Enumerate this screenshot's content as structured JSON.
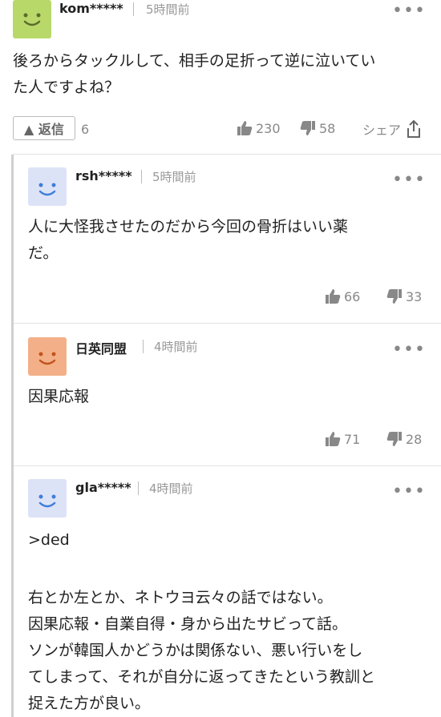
{
  "comment": {
    "username": "kom*****",
    "time": "5時間前",
    "text_line1": "後ろからタックルして、相手の足折って逆に泣いてい",
    "text_line2": "た人ですよね？",
    "reply_label": "▲ 返信",
    "reply_count": "6",
    "likes": "230",
    "dislikes": "58",
    "share": "シェア",
    "avatar_color": "#b9d86a"
  },
  "replies": [
    {
      "username": "rsh*****",
      "time": "5時間前",
      "lines": [
        "人に大怪我させたのだから今回の骨折はいい薬",
        "だ。"
      ],
      "likes": "66",
      "dislikes": "33",
      "avatar_color": "#dde3f7"
    },
    {
      "username": "日英同盟",
      "time": "4時間前",
      "lines": [
        "因果応報"
      ],
      "likes": "71",
      "dislikes": "28",
      "avatar_color": "#f3b088"
    },
    {
      "username": "gla*****",
      "time": "4時間前",
      "lines": [
        ">ded",
        "",
        "右とか左とか、ネトウヨ云々の話ではない。",
        "因果応報・自業自得・身から出たサビって話。",
        "ソンが韓国人かどうかは関係ない、悪い行いをし",
        "てしまって、それが自分に返ってきたという教訓と",
        "捉えた方が良い。"
      ],
      "avatar_color": "#dde3f7"
    }
  ]
}
